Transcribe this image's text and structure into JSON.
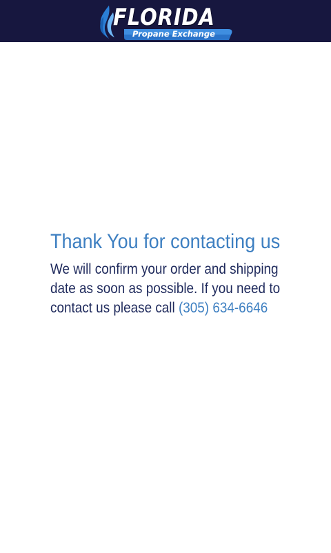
{
  "header": {
    "logo_title": "FLORIDA",
    "logo_subtitle": "Propane Exchange",
    "background_color": "#17173f",
    "logo_icon": "flame-icon"
  },
  "main": {
    "heading": "Thank You for contacting us",
    "message": "We will confirm your order and shipping date as soon as possible. If you need to contact us please call",
    "phone": "(305) 634-6646",
    "accent_color": "#3d7fc1",
    "text_color": "#1f2a5c"
  }
}
